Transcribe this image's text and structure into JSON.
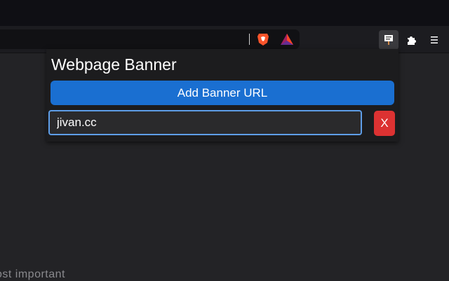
{
  "popup": {
    "title": "Webpage Banner",
    "add_button_label": "Add Banner URL",
    "banner_url_value": "jivan.cc",
    "remove_button_label": "X"
  },
  "page": {
    "partial_text": "ost important"
  },
  "icons": {
    "brave": "brave-lion-icon",
    "rewards": "brave-rewards-triangle-icon",
    "extension": "webpage-banner-extension-icon",
    "extensions": "puzzle-piece-icon",
    "menu": "hamburger-menu-icon"
  },
  "colors": {
    "accent_blue": "#1a6fd1",
    "remove_red": "#dc3232",
    "input_focus": "#5e9ee8"
  }
}
